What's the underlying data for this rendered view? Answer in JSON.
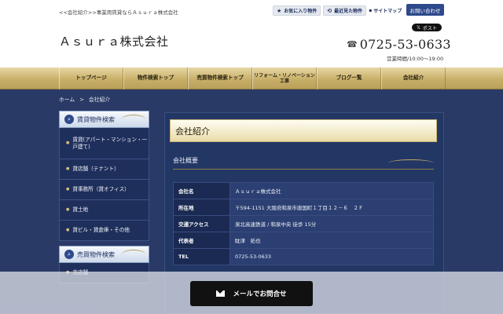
{
  "header": {
    "tagline": "<<会社紹介>>事業用賃貸ならＡｓｕｒａ株式会社",
    "logo": "Ａｓｕｒａ株式会社",
    "links": {
      "favorites": "お気に入り物件",
      "recent": "最近見た物件",
      "sitemap": "サイトマップ"
    },
    "contact_label": "お問い合わせ",
    "post_label": "ポスト",
    "phone": "0725-53-0633",
    "hours": "営業時間/10:00〜19:00"
  },
  "nav": [
    {
      "label": "トップページ"
    },
    {
      "label": "物件検索トップ"
    },
    {
      "label": "売買物件検索トップ"
    },
    {
      "label": "リフォーム・リノベーション工事"
    },
    {
      "label": "ブログ一覧"
    },
    {
      "label": "会社紹介"
    }
  ],
  "breadcrumb": {
    "home": "ホーム",
    "separator": ">",
    "current": "会社紹介"
  },
  "sidebar": {
    "rent_title": "賃貸物件検索",
    "rent_items": [
      {
        "label": "賃貸(アパート・マンション・一戸建て)"
      },
      {
        "label": "貸店舗（テナント）"
      },
      {
        "label": "貸事務所（貸オフィス）"
      },
      {
        "label": "貸土地"
      },
      {
        "label": "貸ビル・貸倉庫・その他"
      }
    ],
    "sale_title": "売買物件検索",
    "sale_items": [
      {
        "label": "売店舗"
      }
    ]
  },
  "main": {
    "title": "会社紹介",
    "subtitle": "会社概要",
    "info": [
      {
        "key": "会社名",
        "value": "Ａｓｕｒａ株式会社"
      },
      {
        "key": "所在地",
        "value": "〒594-1151 大阪府和泉市唐国町１丁目１２－６　２Ｆ"
      },
      {
        "key": "交通アクセス",
        "value": "泉北高速鉄道 / 和泉中央 徒歩 15分"
      },
      {
        "key": "代表者",
        "value": "眈津　拓也"
      },
      {
        "key": "TEL",
        "value": "0725-53-0633"
      }
    ]
  },
  "mail_cta": "メールでお問合せ",
  "colors": {
    "navy": "#1f2f5c",
    "gold": "#c9b06a",
    "accent": "#2e4a8c"
  }
}
